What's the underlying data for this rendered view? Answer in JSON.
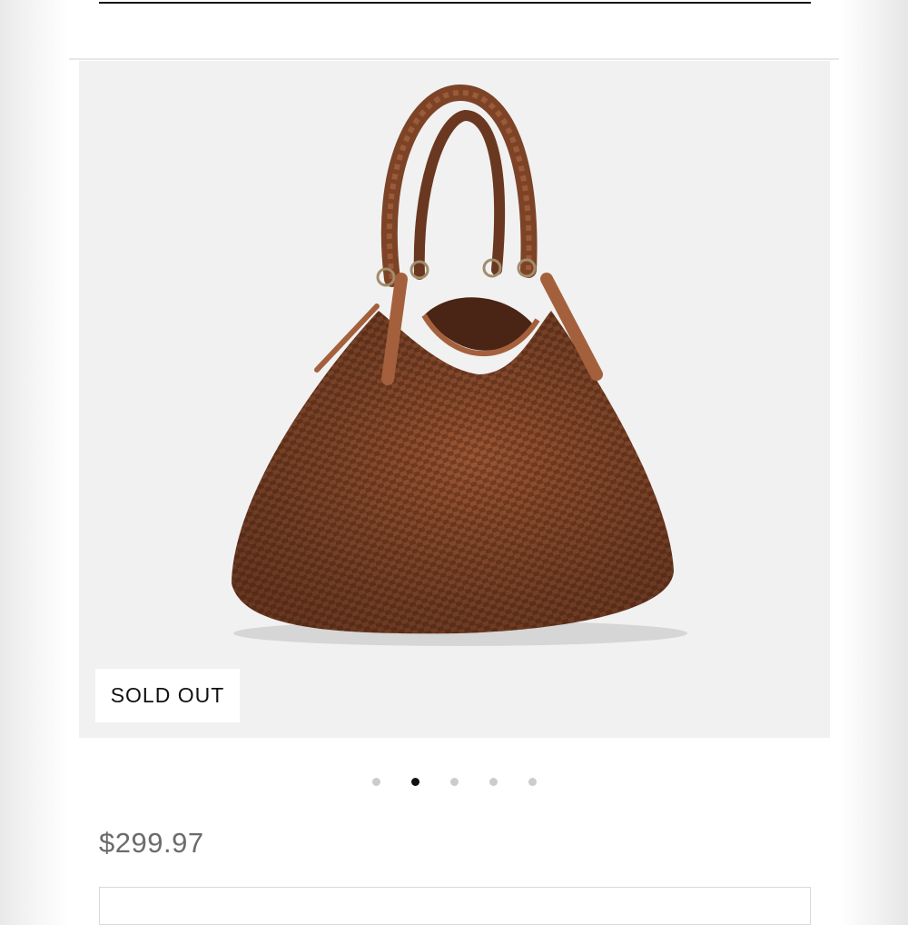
{
  "product": {
    "status_badge": "SOLD OUT",
    "price": "$299.97",
    "image_icon": "handbag-image",
    "colors": {
      "leather": "#8a4a2b",
      "leather_dark": "#5c2f1a",
      "background": "#f1f1f1"
    }
  },
  "gallery": {
    "slide_count": 5,
    "active_index": 1
  }
}
